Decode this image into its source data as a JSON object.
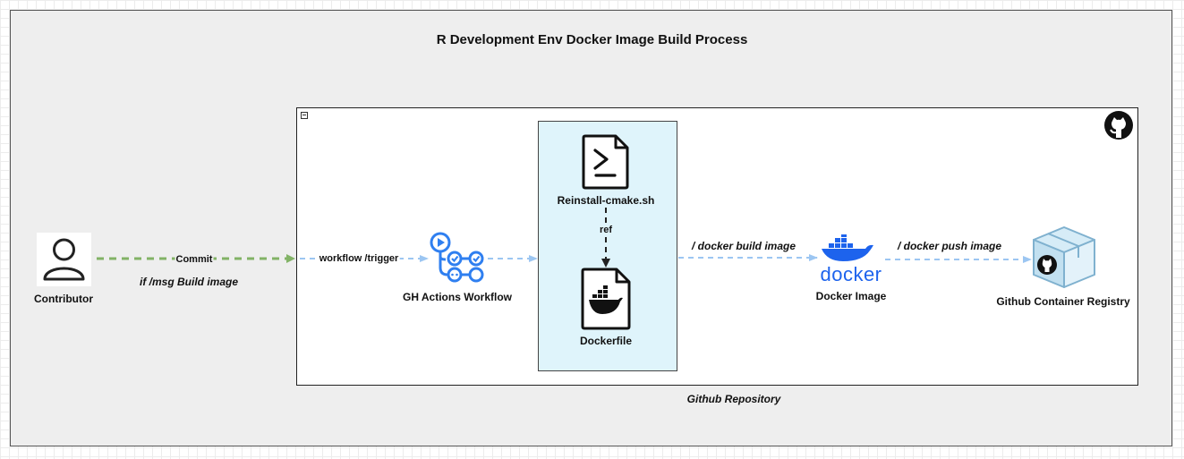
{
  "diagram": {
    "title": "R Development Env Docker Image Build Process",
    "container_caption": "Github Repository",
    "nodes": {
      "contributor": "Contributor",
      "gh_actions": "GH Actions Workflow",
      "reinstall_script": "Reinstall-cmake.sh",
      "dockerfile": "Dockerfile",
      "docker_image": "Docker Image",
      "registry": "Github Container Registry",
      "docker_wordmark": "docker"
    },
    "edges": {
      "commit": "Commit",
      "commit_condition": "if /msg Build image",
      "trigger": "workflow /trigger",
      "ref": "ref",
      "build": "/ docker build image",
      "push": "/ docker push image"
    },
    "colors": {
      "commit_arrow": "#82b366",
      "flow_arrow": "#9cc6f2",
      "panel_fill": "#dff4fb",
      "outer_fill": "#eeeeee",
      "actions_blue": "#2f7ff0",
      "docker_blue": "#1d63ed"
    }
  }
}
